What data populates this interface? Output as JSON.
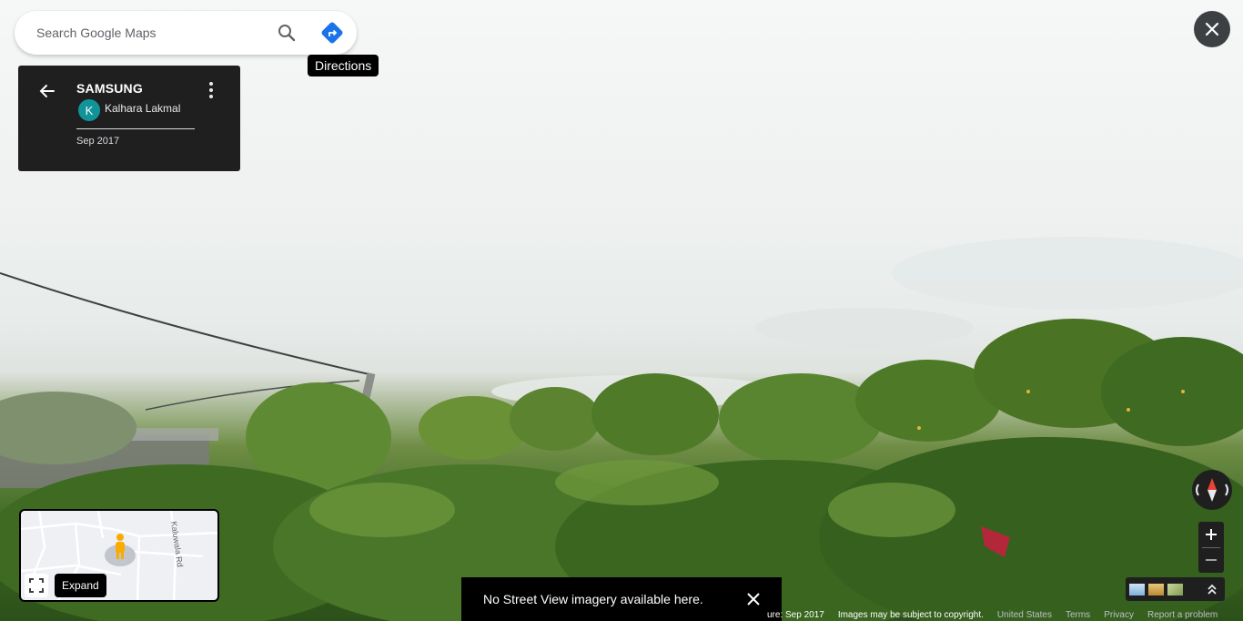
{
  "search": {
    "placeholder": "Search Google Maps",
    "search_icon": "search-icon",
    "directions_icon": "directions-icon"
  },
  "tooltips": {
    "directions": "Directions",
    "expand": "Expand"
  },
  "card": {
    "title": "SAMSUNG",
    "avatar_letter": "K",
    "author": "Kalhara Lakmal",
    "date": "Sep 2017"
  },
  "minimap": {
    "road_label": "Kaluwala Rd"
  },
  "toast": {
    "message": "No Street View imagery available here."
  },
  "footer": {
    "capture": "ure: Sep 2017",
    "copyright": "Images may be subject to copyright.",
    "country": "United States",
    "terms": "Terms",
    "privacy": "Privacy",
    "report": "Report a problem"
  },
  "colors": {
    "avatar": "#12939a",
    "directions_blue": "#1a73e8",
    "panel_bg": "#1f1f1f",
    "compass_red": "#ea4335"
  }
}
